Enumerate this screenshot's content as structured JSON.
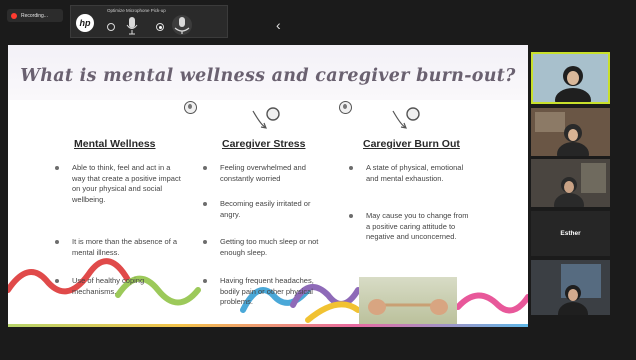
{
  "recording": {
    "label": "Recording..."
  },
  "mic_toolbar": {
    "title": "Optimize Microphone Pick-up",
    "logo_text": "hp"
  },
  "slide": {
    "title": "What is mental wellness and caregiver burn-out?",
    "columns": [
      {
        "heading": "Mental Wellness",
        "bullets": [
          "Able to think, feel and act in a way that create a positive impact on your physical and social wellbeing.",
          "It is more than the absence of a mental illness.",
          "Use of healthy coping mechanisms."
        ]
      },
      {
        "heading": "Caregiver Stress",
        "bullets": [
          "Feeling overwhelmed and constantly worried",
          "Becoming easily irritated or angry.",
          "Getting too much sleep or not enough sleep.",
          "Having frequent headaches, bodily pain or other physical problems."
        ]
      },
      {
        "heading": "Caregiver Burn Out",
        "bullets": [
          "A state of physical, emotional and mental exhaustion.",
          "May cause you to change from a positive caring attitude to negative and unconcerned."
        ]
      }
    ],
    "colors": {
      "title": "#6a6170",
      "wave_red": "#e04a4a",
      "wave_yellow": "#f1c232",
      "wave_purple": "#8e6ab8",
      "wave_blue": "#4aa8d8",
      "wave_green": "#9cc95a"
    }
  },
  "participants": [
    {
      "name": "",
      "active": true
    },
    {
      "name": "",
      "active": false
    },
    {
      "name": "",
      "active": false
    },
    {
      "name": "Esther",
      "active": false
    },
    {
      "name": "",
      "active": false
    }
  ]
}
